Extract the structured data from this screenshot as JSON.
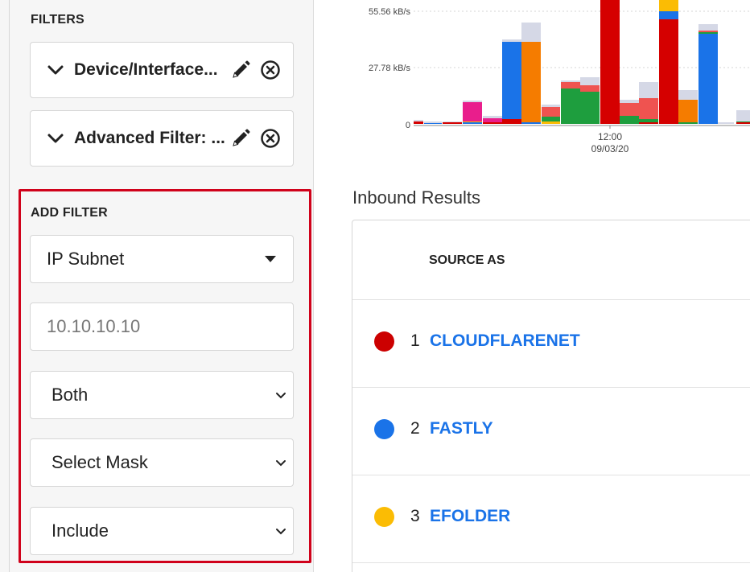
{
  "filters": {
    "title": "FILTERS",
    "items": [
      {
        "label": "Device/Interface..."
      },
      {
        "label": "Advanced Filter: ..."
      }
    ]
  },
  "add_filter": {
    "title": "ADD FILTER",
    "type_select": {
      "value": "IP Subnet"
    },
    "ip_input": {
      "value": "",
      "placeholder": "10.10.10.10"
    },
    "direction_select": {
      "value": "Both"
    },
    "mask_select": {
      "value": "Select Mask"
    },
    "mode_select": {
      "value": "Include"
    }
  },
  "chart_data": {
    "type": "bar",
    "y_ticks": [
      "55.56 kB/s",
      "27.78 kB/s",
      "0"
    ],
    "x_tick_time": "12:00",
    "x_tick_date": "09/03/20",
    "stacked": true,
    "colors": {
      "cloudflarenet": "#d50000",
      "fastly": "#1a73e8",
      "efolder": "#fbbc04",
      "orange": "#f57c00",
      "green": "#1e9e3e",
      "salmon": "#ef5350",
      "pink": "#e91e8c",
      "other": "#d5d8e6"
    }
  },
  "results": {
    "title": "Inbound Results",
    "column_header": "SOURCE AS",
    "rows": [
      {
        "rank": "1",
        "name": "CLOUDFLARENET",
        "color": "#cc0000"
      },
      {
        "rank": "2",
        "name": "FASTLY",
        "color": "#1a73e8"
      },
      {
        "rank": "3",
        "name": "EFOLDER",
        "color": "#fbbc04"
      }
    ]
  }
}
